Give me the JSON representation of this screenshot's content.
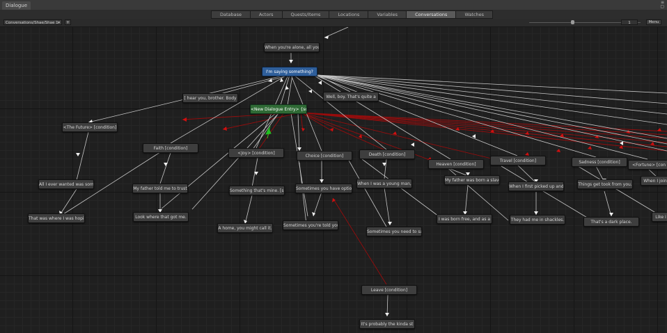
{
  "window": {
    "title": "Dialogue",
    "controls_glyph": "≡\n▢"
  },
  "tabs": [
    {
      "label": "Database",
      "active": false
    },
    {
      "label": "Actors",
      "active": false
    },
    {
      "label": "Quests/Items",
      "active": false
    },
    {
      "label": "Locations",
      "active": false
    },
    {
      "label": "Variables",
      "active": false
    },
    {
      "label": "Conversations",
      "active": true
    },
    {
      "label": "Watches",
      "active": false
    }
  ],
  "subbar": {
    "conversation": "Conversations/Shae/Shae 1",
    "dropdown_glyph": "▾",
    "add_button": "+",
    "zoom": "1",
    "menu_label": "Menu"
  },
  "colors": {
    "link": "#c8c8c8",
    "cross_link": "#b01010",
    "green_arrow": "#22c022",
    "start_node": "#2e5e9a",
    "selected_node": "#2f6a35"
  },
  "nodes": [
    {
      "id": "n_alone",
      "text": "When you're alone, all you",
      "style": "normal"
    },
    {
      "id": "n_saying",
      "text": "I'm saying something?",
      "style": "blue"
    },
    {
      "id": "n_hear",
      "text": "[ hear you, brother. Body",
      "style": "normal"
    },
    {
      "id": "n_wellboy",
      "text": "Well, boy. That's quite a",
      "style": "normal"
    },
    {
      "id": "n_newentry",
      "text": "<New Dialogue Entry> {scr",
      "style": "green"
    },
    {
      "id": "n_future",
      "text": "<The Future> [condition]",
      "style": "normal"
    },
    {
      "id": "n_faith",
      "text": "Faith [condition]",
      "style": "normal"
    },
    {
      "id": "n_joy",
      "text": "<Joy> [condition]",
      "style": "normal"
    },
    {
      "id": "n_choice",
      "text": "Choice [condition]",
      "style": "normal"
    },
    {
      "id": "n_death",
      "text": "Death [condition]",
      "style": "normal"
    },
    {
      "id": "n_heaven",
      "text": "Heaven [condition]",
      "style": "normal"
    },
    {
      "id": "n_travel",
      "text": "Travel [condition]",
      "style": "normal"
    },
    {
      "id": "n_sadness",
      "text": "Sadness [condition]",
      "style": "normal"
    },
    {
      "id": "n_fortune",
      "text": "<Fortune> [con",
      "style": "normal"
    },
    {
      "id": "n_allever",
      "text": "All I ever wanted was some",
      "style": "normal"
    },
    {
      "id": "n_father",
      "text": "My father told me to trust",
      "style": "normal"
    },
    {
      "id": "n_mine",
      "text": "Something that's mine. [sn",
      "style": "normal"
    },
    {
      "id": "n_options",
      "text": "Sometimes you have options",
      "style": "normal"
    },
    {
      "id": "n_young",
      "text": "When I was a young man, it",
      "style": "normal"
    },
    {
      "id": "n_slave",
      "text": "My father was born a slave",
      "style": "normal"
    },
    {
      "id": "n_picked",
      "text": "When I first picked up and",
      "style": "normal"
    },
    {
      "id": "n_took",
      "text": "Things get took from you.",
      "style": "normal"
    },
    {
      "id": "n_whenijoin",
      "text": "When I join",
      "style": "normal"
    },
    {
      "id": "n_wherei",
      "text": "That was where I was hopin",
      "style": "normal"
    },
    {
      "id": "n_look",
      "text": "Look where that got me.",
      "style": "normal"
    },
    {
      "id": "n_home",
      "text": "A home, you might call it.",
      "style": "normal"
    },
    {
      "id": "n_told",
      "text": "Sometimes you're told you",
      "style": "normal"
    },
    {
      "id": "n_salt",
      "text": "Sometimes you need to salt",
      "style": "normal"
    },
    {
      "id": "n_free",
      "text": "I was born free, and as a",
      "style": "normal"
    },
    {
      "id": "n_shackles",
      "text": "They had me in shackles.",
      "style": "normal"
    },
    {
      "id": "n_dark",
      "text": "That's a dark place.",
      "style": "normal"
    },
    {
      "id": "n_like",
      "text": "Like i",
      "style": "normal"
    },
    {
      "id": "n_leave",
      "text": "Leave [condition]",
      "style": "normal"
    },
    {
      "id": "n_kinda",
      "text": "It's probably the kinda st",
      "style": "normal"
    }
  ]
}
